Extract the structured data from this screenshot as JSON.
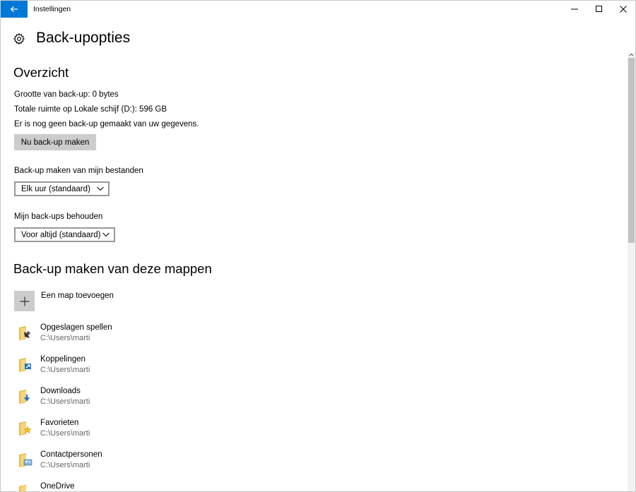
{
  "window": {
    "title": "Instellingen"
  },
  "page": {
    "title": "Back-upopties"
  },
  "overview": {
    "heading": "Overzicht",
    "backup_size": "Grootte van back-up: 0 bytes",
    "total_space": "Totale ruimte op Lokale schijf (D:): 596 GB",
    "status": "Er is nog geen back-up gemaakt van uw gegevens.",
    "backup_now_label": "Nu back-up maken"
  },
  "frequency": {
    "label": "Back-up maken van mijn bestanden",
    "selected": "Elk uur (standaard)"
  },
  "retention": {
    "label": "Mijn back-ups behouden",
    "selected": "Voor altijd (standaard)"
  },
  "folders": {
    "heading": "Back-up maken van deze mappen",
    "add_label": "Een map toevoegen",
    "items": [
      {
        "name": "Opgeslagen spellen",
        "path": "C:\\Users\\marti",
        "icon": "saved-games-icon"
      },
      {
        "name": "Koppelingen",
        "path": "C:\\Users\\marti",
        "icon": "links-icon"
      },
      {
        "name": "Downloads",
        "path": "C:\\Users\\marti",
        "icon": "downloads-icon"
      },
      {
        "name": "Favorieten",
        "path": "C:\\Users\\marti",
        "icon": "favorites-icon"
      },
      {
        "name": "Contactpersonen",
        "path": "C:\\Users\\marti",
        "icon": "contacts-icon"
      },
      {
        "name": "OneDrive",
        "path": "",
        "icon": "onedrive-icon"
      }
    ]
  },
  "colors": {
    "accent": "#0078d7",
    "button_gray": "#cccccc",
    "secondary_text": "#666666"
  }
}
